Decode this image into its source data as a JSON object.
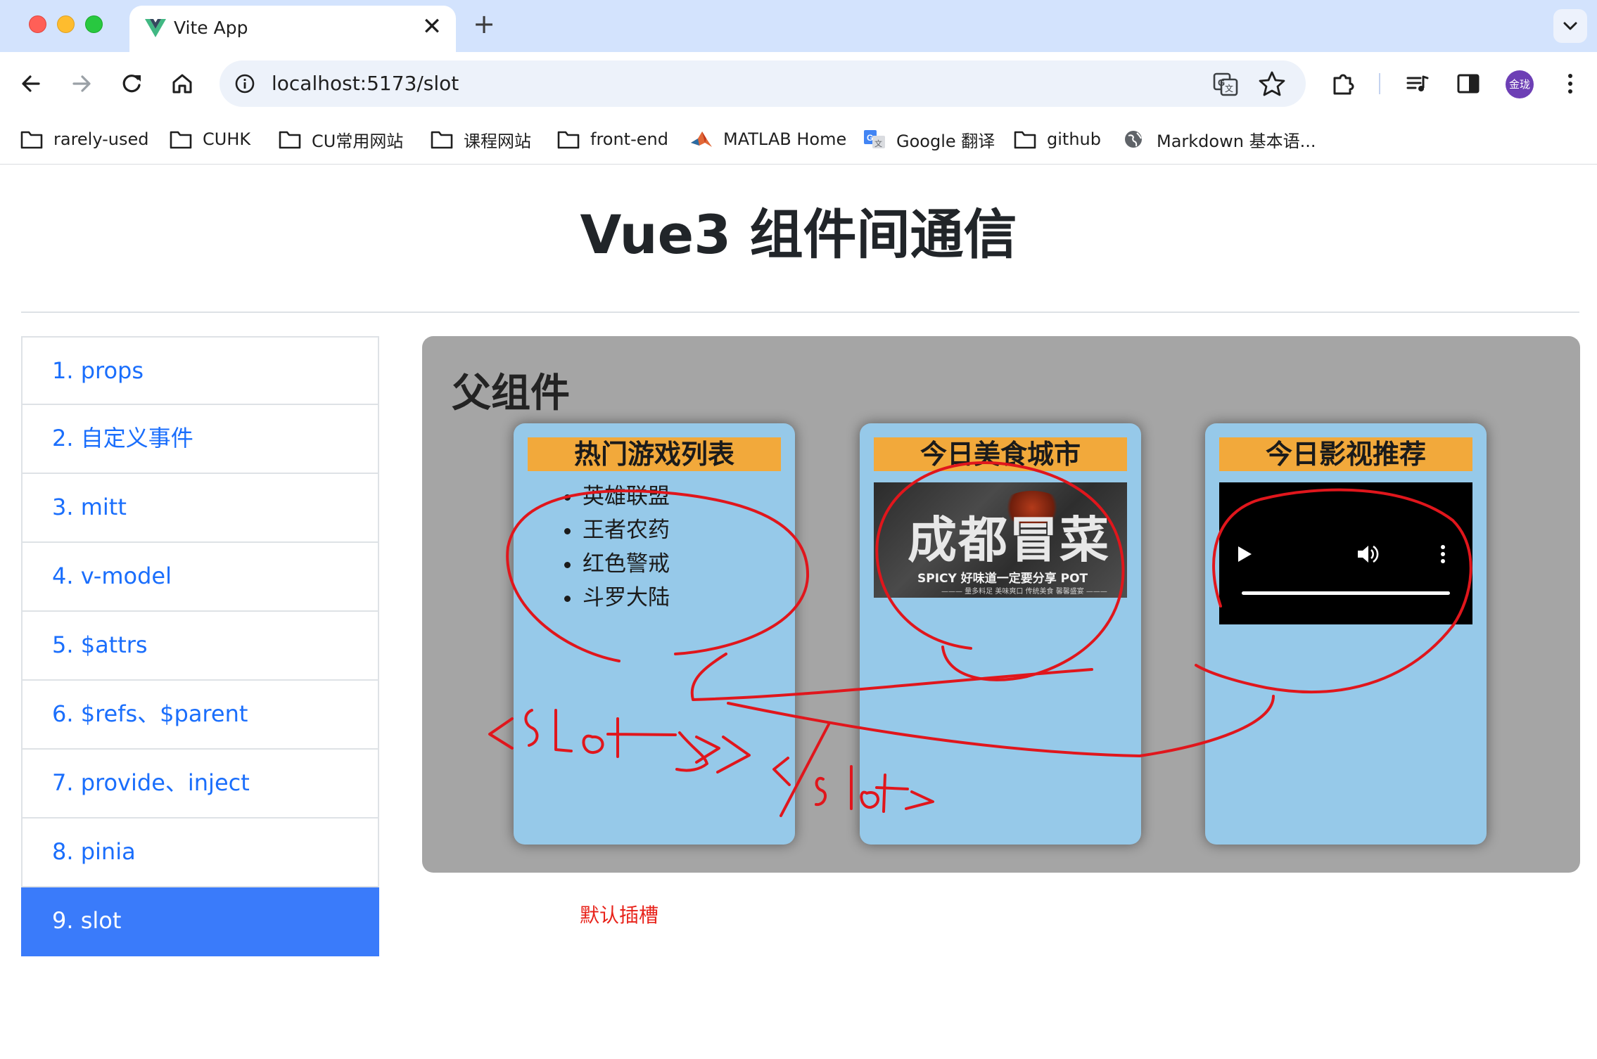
{
  "browser": {
    "tab_title": "Vite App",
    "tab_close": "✕",
    "new_tab": "+",
    "url": "localhost:5173/slot",
    "profile": "金珑"
  },
  "bookmarks": [
    {
      "label": "rarely-used",
      "icon": "folder-icon"
    },
    {
      "label": "CUHK",
      "icon": "folder-icon"
    },
    {
      "label": "CU常用网站",
      "icon": "folder-icon"
    },
    {
      "label": "课程网站",
      "icon": "folder-icon"
    },
    {
      "label": "front-end",
      "icon": "folder-icon"
    },
    {
      "label": "MATLAB Home",
      "icon": "matlab-icon"
    },
    {
      "label": "Google 翻译",
      "icon": "google-translate-icon"
    },
    {
      "label": "github",
      "icon": "folder-icon"
    },
    {
      "label": "Markdown 基本语...",
      "icon": "globe-icon"
    }
  ],
  "page": {
    "title": "Vue3 组件间通信",
    "nav": [
      "1. props",
      "2. 自定义事件",
      "3. mitt",
      "4. v-model",
      "5. $attrs",
      "6. $refs、$parent",
      "7. provide、inject",
      "8. pinia",
      "9. slot"
    ],
    "active_nav": "9. slot",
    "father_title": "父组件",
    "cards": [
      {
        "title": "热门游戏列表",
        "items": [
          "英雄联盟",
          "王者农药",
          "红色警戒",
          "斗罗大陆"
        ]
      },
      {
        "title": "今日美食城市",
        "image_text": {
          "main": "成都冒菜",
          "spicy": "SPICY 好味道一定要分享 POT",
          "sub": "——— 量多料足 美味爽口 传统美食 馨馨盛宴 ———"
        }
      },
      {
        "title": "今日影视推荐"
      }
    ],
    "caption": "默认插槽"
  },
  "annotation": {
    "color": "#e0161c",
    "text": "<slot> </slot>"
  },
  "colors": {
    "tabstrip": "#d3e3fd",
    "nav_link": "#1a6efc",
    "nav_active": "#3a7bfa",
    "father_bg": "#a5a5a5",
    "card_bg": "#96c9e9",
    "card_title_bg": "#f2a93b"
  }
}
